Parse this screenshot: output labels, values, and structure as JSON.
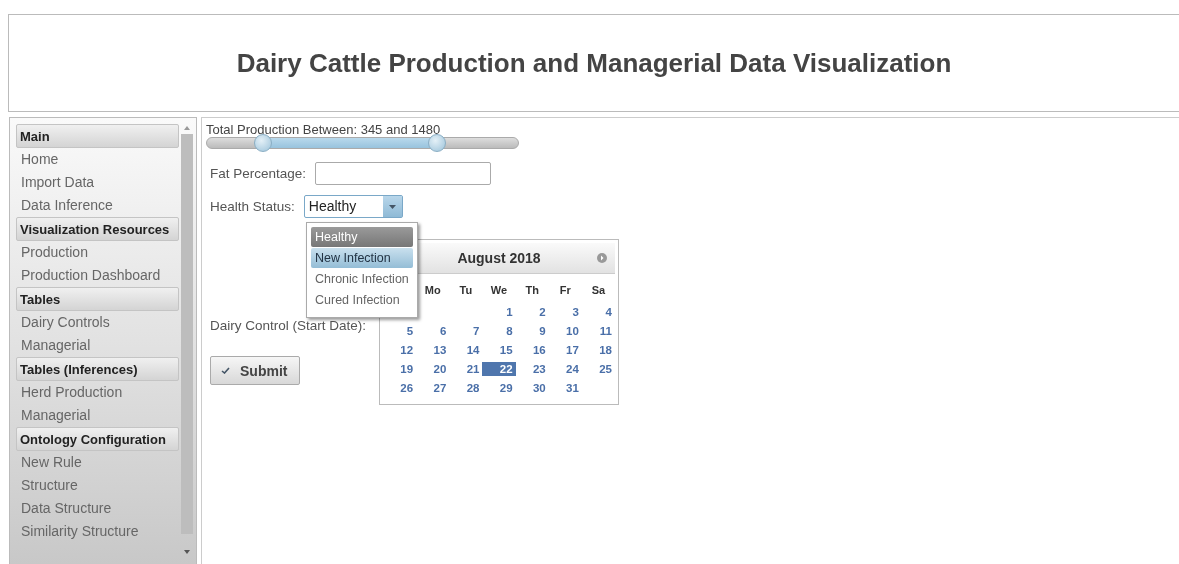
{
  "header": {
    "title": "Dairy Cattle Production and Managerial Data Visualization"
  },
  "sidebar": {
    "sections": [
      {
        "title": "Main",
        "items": [
          {
            "label": "Home"
          },
          {
            "label": "Import Data"
          },
          {
            "label": "Data Inference"
          }
        ]
      },
      {
        "title": "Visualization Resources",
        "items": [
          {
            "label": "Production"
          },
          {
            "label": "Production Dashboard"
          }
        ]
      },
      {
        "title": "Tables",
        "items": [
          {
            "label": "Dairy Controls"
          },
          {
            "label": "Managerial"
          }
        ]
      },
      {
        "title": "Tables (Inferences)",
        "items": [
          {
            "label": "Herd Production"
          },
          {
            "label": "Managerial"
          }
        ]
      },
      {
        "title": "Ontology Configuration",
        "items": [
          {
            "label": "New Rule"
          },
          {
            "label": "Structure"
          },
          {
            "label": "Data Structure"
          },
          {
            "label": "Similarity Structure"
          }
        ]
      }
    ]
  },
  "form": {
    "production": {
      "label": "Total Production Between: 345 and 1480",
      "thumbs": [
        {
          "level": 0.18
        },
        {
          "level": 0.74
        }
      ]
    },
    "fat_percentage": {
      "label": "Fat Percentage:"
    },
    "health_status": {
      "label": "Health Status:",
      "value": "Healthy",
      "options": [
        {
          "label": "Healthy",
          "selected": true,
          "hovered": false
        },
        {
          "label": "New Infection",
          "selected": false,
          "hovered": true
        },
        {
          "label": "Chronic Infection",
          "selected": false,
          "hovered": false
        },
        {
          "label": "Cured Infection",
          "selected": false,
          "hovered": false
        }
      ]
    },
    "dairy_control": {
      "label": "Dairy Control (Start Date):"
    },
    "submit": "Submit"
  },
  "calendar": {
    "title": "August 2018",
    "weekdays": [
      "Mo",
      "Tu",
      "We",
      "Th",
      "Fr",
      "Sa"
    ],
    "weeks": [
      [
        {
          "kind": "blank"
        },
        {
          "kind": "blank"
        },
        {
          "kind": "blank"
        },
        {
          "kind": "day",
          "day": "1",
          "selected": false
        },
        {
          "kind": "day",
          "day": "2",
          "selected": false
        },
        {
          "kind": "day",
          "day": "3",
          "selected": false
        },
        {
          "kind": "day",
          "day": "4",
          "selected": false
        }
      ],
      [
        {
          "kind": "day",
          "day": "5",
          "selected": false
        },
        {
          "kind": "day",
          "day": "6",
          "selected": false
        },
        {
          "kind": "day",
          "day": "7",
          "selected": false
        },
        {
          "kind": "day",
          "day": "8",
          "selected": false
        },
        {
          "kind": "day",
          "day": "9",
          "selected": false
        },
        {
          "kind": "day",
          "day": "10",
          "selected": false
        },
        {
          "kind": "day",
          "day": "11",
          "selected": false
        }
      ],
      [
        {
          "kind": "day",
          "day": "12",
          "selected": false
        },
        {
          "kind": "day",
          "day": "13",
          "selected": false
        },
        {
          "kind": "day",
          "day": "14",
          "selected": false
        },
        {
          "kind": "day",
          "day": "15",
          "selected": false
        },
        {
          "kind": "day",
          "day": "16",
          "selected": false
        },
        {
          "kind": "day",
          "day": "17",
          "selected": false
        },
        {
          "kind": "day",
          "day": "18",
          "selected": false
        }
      ],
      [
        {
          "kind": "day",
          "day": "19",
          "selected": false
        },
        {
          "kind": "day",
          "day": "20",
          "selected": false
        },
        {
          "kind": "day",
          "day": "21",
          "selected": false
        },
        {
          "kind": "day",
          "day": "22",
          "selected": true
        },
        {
          "kind": "day",
          "day": "23",
          "selected": false
        },
        {
          "kind": "day",
          "day": "24",
          "selected": false
        },
        {
          "kind": "day",
          "day": "25",
          "selected": false
        }
      ],
      [
        {
          "kind": "day",
          "day": "26",
          "selected": false
        },
        {
          "kind": "day",
          "day": "27",
          "selected": false
        },
        {
          "kind": "day",
          "day": "28",
          "selected": false
        },
        {
          "kind": "day",
          "day": "29",
          "selected": false
        },
        {
          "kind": "day",
          "day": "30",
          "selected": false
        },
        {
          "kind": "day",
          "day": "31",
          "selected": false
        },
        {
          "kind": "blank"
        }
      ]
    ]
  }
}
